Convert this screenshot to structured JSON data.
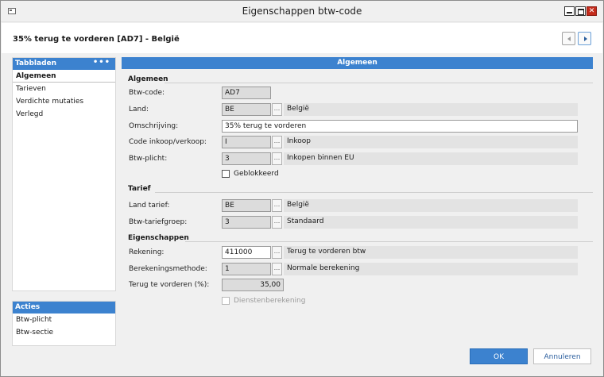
{
  "window": {
    "title": "Eigenschappen btw-code"
  },
  "header": {
    "record_title": "35% terug te vorderen [AD7] - België"
  },
  "sidebar": {
    "tabs_header": "Tabbladen",
    "tabs_more": "•••",
    "tabs": [
      "Algemeen",
      "Tarieven",
      "Verdichte mutaties",
      "Verlegd"
    ],
    "actions_header": "Acties",
    "actions": [
      "Btw-plicht",
      "Btw-sectie"
    ]
  },
  "main": {
    "header": "Algemeen",
    "sections": {
      "algemeen": "Algemeen",
      "tarief": "Tarief",
      "eigenschappen": "Eigenschappen"
    },
    "fields": {
      "btw_code": {
        "label": "Btw-code:",
        "value": "AD7"
      },
      "land": {
        "label": "Land:",
        "value": "BE",
        "desc": "België"
      },
      "omschrijving": {
        "label": "Omschrijving:",
        "value": "35% terug te vorderen"
      },
      "code_inkoop": {
        "label": "Code inkoop/verkoop:",
        "value": "I",
        "desc": "Inkoop"
      },
      "btw_plicht": {
        "label": "Btw-plicht:",
        "value": "3",
        "desc": "Inkopen binnen EU"
      },
      "geblokkeerd": {
        "label": "Geblokkeerd"
      },
      "land_tarief": {
        "label": "Land tarief:",
        "value": "BE",
        "desc": "België"
      },
      "btw_tariefgroep": {
        "label": "Btw-tariefgroep:",
        "value": "3",
        "desc": "Standaard"
      },
      "rekening": {
        "label": "Rekening:",
        "value": "411000",
        "desc": "Terug te vorderen btw"
      },
      "berekeningsmethode": {
        "label": "Berekeningsmethode:",
        "value": "1",
        "desc": "Normale berekening"
      },
      "terug_te_vorderen": {
        "label": "Terug te vorderen (%):",
        "value": "35,00"
      },
      "dienstenberekening": {
        "label": "Dienstenberekening"
      }
    },
    "lookup_glyph": "..."
  },
  "footer": {
    "ok": "OK",
    "cancel": "Annuleren"
  }
}
